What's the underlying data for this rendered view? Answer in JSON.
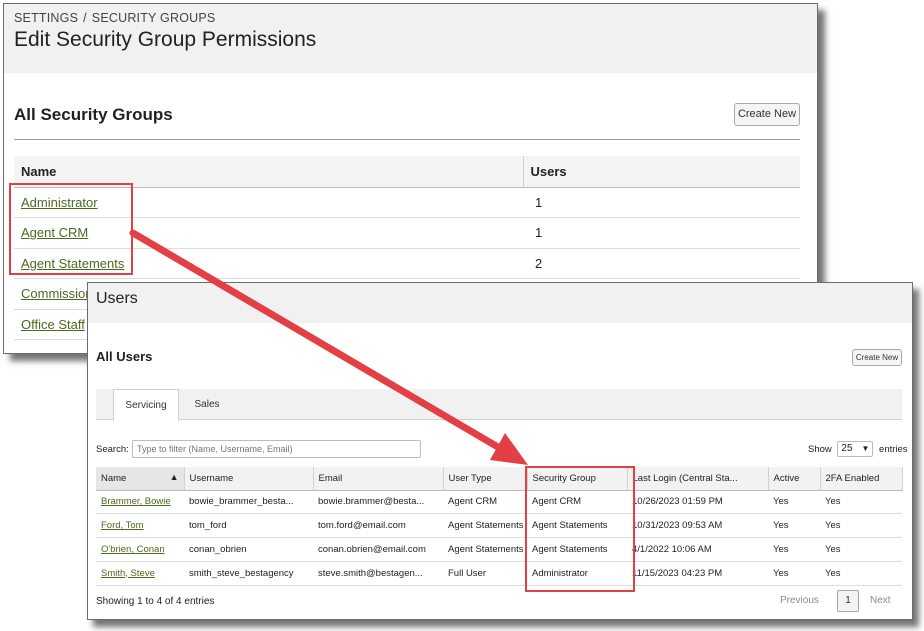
{
  "security_groups_window": {
    "breadcrumb": [
      "SETTINGS",
      "SECURITY GROUPS"
    ],
    "breadcrumb_sep": "/",
    "page_title": "Edit Security Group Permissions",
    "section_title": "All Security Groups",
    "create_new_label": "Create New",
    "columns": [
      "Name",
      "Users"
    ],
    "rows": [
      {
        "name": "Administrator",
        "users": "1"
      },
      {
        "name": "Agent CRM",
        "users": "1"
      },
      {
        "name": "Agent Statements",
        "users": "2"
      },
      {
        "name": "Commissions",
        "users": ""
      },
      {
        "name": "Office Staff",
        "users": ""
      }
    ]
  },
  "users_window": {
    "title": "Users",
    "section_title": "All Users",
    "create_new_label": "Create New",
    "tabs": [
      "Servicing",
      "Sales"
    ],
    "search_label": "Search:",
    "search_placeholder": "Type to filter (Name, Username, Email)",
    "show_label": "Show",
    "show_value": "25",
    "entries_label": "entries",
    "columns": [
      "Name",
      "Username",
      "Email",
      "User Type",
      "Security Group",
      "Last Login (Central Sta...",
      "Active",
      "2FA Enabled"
    ],
    "rows": [
      {
        "name": "Brammer, Bowie",
        "username": "bowie_brammer_besta...",
        "email": "bowie.brammer@besta...",
        "user_type": "Agent CRM",
        "security_group": "Agent CRM",
        "last_login": "10/26/2023 01:59 PM",
        "active": "Yes",
        "twofa": "Yes"
      },
      {
        "name": "Ford, Tom",
        "username": "tom_ford",
        "email": "tom.ford@email.com",
        "user_type": "Agent Statements",
        "security_group": "Agent Statements",
        "last_login": "10/31/2023 09:53 AM",
        "active": "Yes",
        "twofa": "Yes"
      },
      {
        "name": "O'brien, Conan",
        "username": "conan_obrien",
        "email": "conan.obrien@email.com",
        "user_type": "Agent Statements",
        "security_group": "Agent Statements",
        "last_login": "4/1/2022 10:06 AM",
        "active": "Yes",
        "twofa": "Yes"
      },
      {
        "name": "Smith, Steve",
        "username": "smith_steve_bestagency",
        "email": "steve.smith@bestagen...",
        "user_type": "Full User",
        "security_group": "Administrator",
        "last_login": "11/15/2023 04:23 PM",
        "active": "Yes",
        "twofa": "Yes"
      }
    ],
    "showing_text": "Showing 1 to 4 of 4 entries",
    "pagination": {
      "previous": "Previous",
      "current": "1",
      "next": "Next"
    }
  },
  "annotation_color": "#e34046",
  "icons": {
    "sort": "sort-up-icon",
    "select": "chevron-down-icon"
  }
}
